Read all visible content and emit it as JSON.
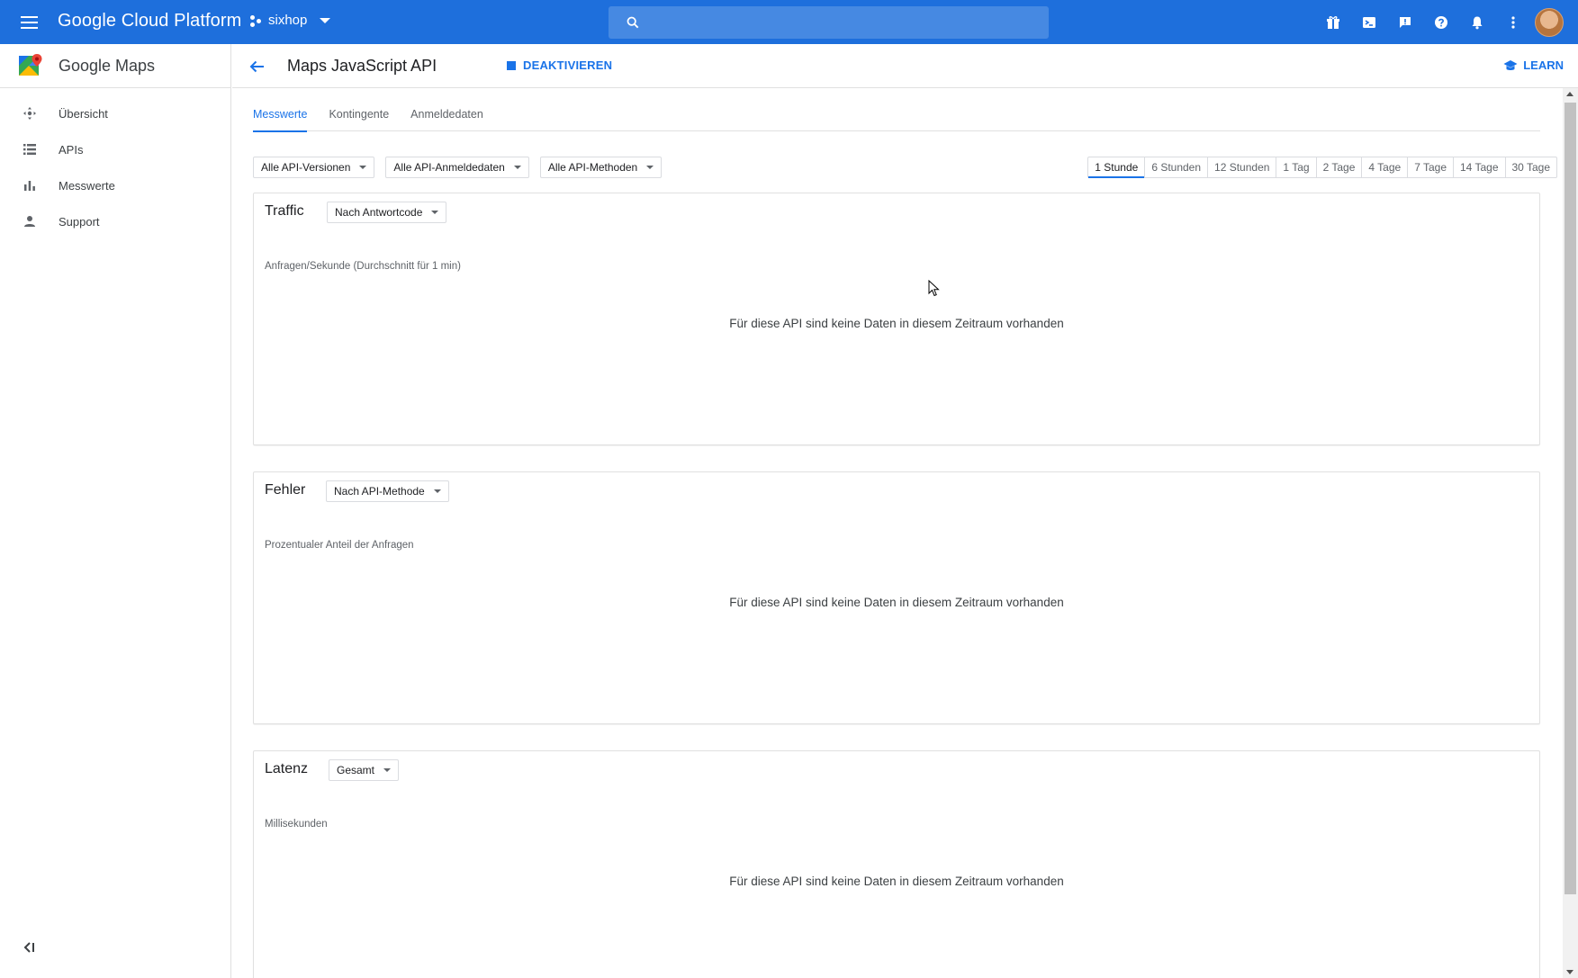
{
  "topbar": {
    "brand": "Google Cloud Platform",
    "project": "sixhop",
    "search_placeholder": "",
    "icons": [
      "gift-icon",
      "terminal-icon",
      "feedback-icon",
      "help-icon",
      "notifications-icon",
      "more-vert-icon",
      "avatar"
    ]
  },
  "sidebar": {
    "product": "Google Maps",
    "items": [
      {
        "label": "Übersicht",
        "icon": "dashboard-icon"
      },
      {
        "label": "APIs",
        "icon": "list-icon"
      },
      {
        "label": "Messwerte",
        "icon": "bar-chart-icon"
      },
      {
        "label": "Support",
        "icon": "person-icon"
      }
    ]
  },
  "header": {
    "title": "Maps JavaScript API",
    "deactivate": "DEAKTIVIEREN",
    "learn": "LEARN"
  },
  "tabs": [
    {
      "label": "Messwerte",
      "active": true
    },
    {
      "label": "Kontingente",
      "active": false
    },
    {
      "label": "Anmeldedaten",
      "active": false
    }
  ],
  "filters": {
    "versions": "Alle API-Versionen",
    "credentials": "Alle API-Anmeldedaten",
    "methods": "Alle API-Methoden"
  },
  "ranges": [
    "1 Stunde",
    "6 Stunden",
    "12 Stunden",
    "1 Tag",
    "2 Tage",
    "4 Tage",
    "7 Tage",
    "14 Tage",
    "30 Tage"
  ],
  "active_range": "1 Stunde",
  "cards": {
    "traffic": {
      "title": "Traffic",
      "dropdown": "Nach Antwortcode",
      "unit": "Anfragen/Sekunde (Durchschnitt für 1 min)",
      "empty": "Für diese API sind keine Daten in diesem Zeitraum vorhanden"
    },
    "errors": {
      "title": "Fehler",
      "dropdown": "Nach API-Methode",
      "unit": "Prozentualer Anteil der Anfragen",
      "empty": "Für diese API sind keine Daten in diesem Zeitraum vorhanden"
    },
    "latency": {
      "title": "Latenz",
      "dropdown": "Gesamt",
      "unit": "Millisekunden",
      "empty": "Für diese API sind keine Daten in diesem Zeitraum vorhanden"
    }
  },
  "colors": {
    "topbar": "#1e6fdc",
    "accent": "#1a73e8"
  }
}
